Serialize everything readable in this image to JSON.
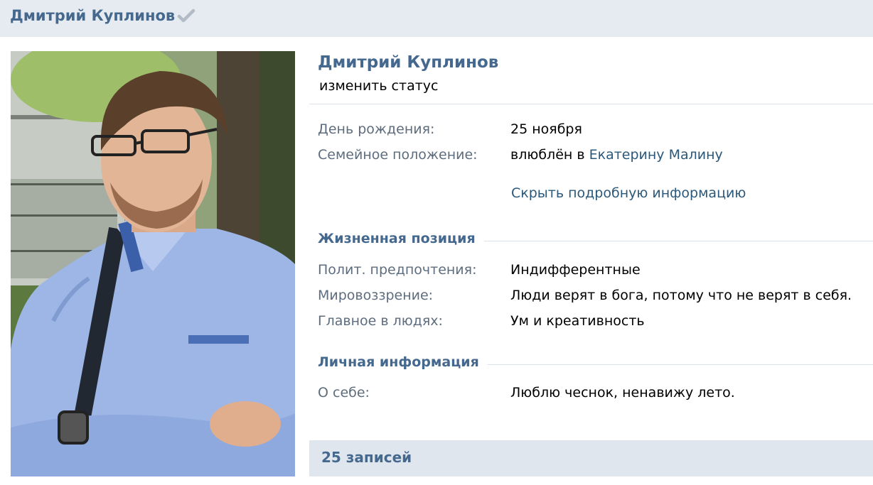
{
  "header": {
    "title": "Дмитрий Куплинов",
    "verified_icon": "checkmark-icon"
  },
  "profile": {
    "name": "Дмитрий Куплинов",
    "status_link": "изменить статус",
    "birthday": {
      "label": "День рождения:",
      "value": "25 ноября"
    },
    "relationship": {
      "label": "Семейное положение:",
      "prefix": "влюблён в",
      "partner": "Екатерину Малину"
    },
    "hide_details_link": "Скрыть подробную информацию"
  },
  "life_position": {
    "title": "Жизненная позиция",
    "rows": [
      {
        "label": "Полит. предпочтения:",
        "value": "Индифферентные",
        "is_link": false
      },
      {
        "label": "Мировоззрение:",
        "value": "Люди верят в бога, потому что не верят в себя.",
        "is_link": true
      },
      {
        "label": "Главное в людях:",
        "value": "Ум и креативность",
        "is_link": true
      }
    ]
  },
  "personal_info": {
    "title": "Личная информация",
    "rows": [
      {
        "label": "О себе:",
        "value": "Люблю чеснок, ненавижу лето."
      }
    ]
  },
  "posts": {
    "label": "25 записей"
  },
  "colors": {
    "header_bg": "#e6ebf1",
    "accent": "#45688e",
    "link": "#2b587a",
    "label": "#5e6d7d",
    "posts_bar_bg": "#dfe6ed"
  }
}
